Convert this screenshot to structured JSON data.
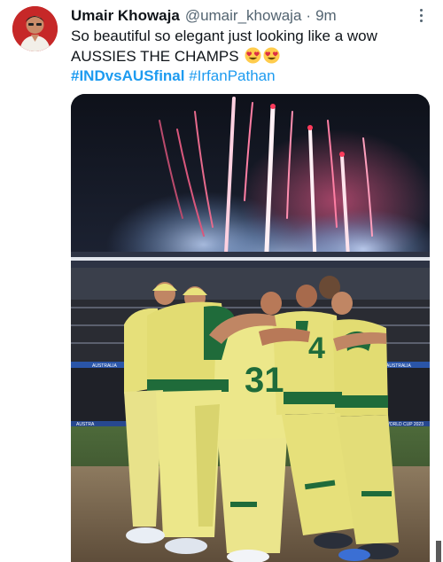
{
  "tweet": {
    "display_name": "Umair Khowaja",
    "handle": "@umair_khowaja",
    "separator": "·",
    "time": "9m",
    "text_line1": "So beautiful so elegant just looking like a wow",
    "text_line2": "AUSSIES THE CHAMPS",
    "emoji": [
      "smiling-face-with-heart-eyes",
      "smiling-face-with-heart-eyes"
    ],
    "hashtags": [
      "#INDvsAUSfinal",
      "#IrfanPathan"
    ]
  },
  "media": {
    "jersey_numbers": [
      "4",
      "31"
    ],
    "boards": [
      "AUSTRALIA",
      "AUSTRALIA",
      "AUSTRA",
      "WORLD CUP 2023"
    ]
  },
  "colors": {
    "link": "#1d9bf0",
    "secondary_text": "#536471",
    "jersey_yellow": "#e6e07a",
    "jersey_green": "#1f6b3a"
  }
}
